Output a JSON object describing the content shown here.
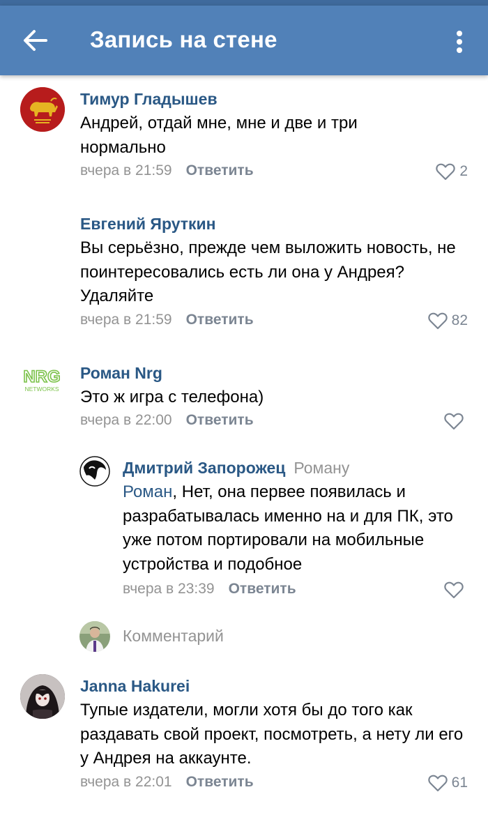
{
  "header": {
    "title": "Запись на стене"
  },
  "comments": [
    {
      "author": "Тимур Гладышев",
      "text": "Андрей, отдай мне, мне и две и три нормально",
      "time": "вчера в 21:59",
      "reply_label": "Ответить",
      "likes": "2",
      "avatar_icon": "caesars-legion-bull-icon"
    },
    {
      "author": "Евгений Яруткин",
      "text": "Вы серьёзно, прежде чем выложить новость, не поинтересовались есть ли она у Андрея? Удаляйте",
      "time": "вчера в 21:59",
      "reply_label": "Ответить",
      "likes": "82"
    },
    {
      "author": "Роман Nrg",
      "text": "Это ж игра с телефона)",
      "time": "вчера в 22:00",
      "reply_label": "Ответить",
      "likes": "",
      "avatar_logo_text_top": "NRG",
      "avatar_logo_text_bottom": "NETWORKS"
    },
    {
      "author": "Дмитрий Запорожец",
      "reply_to": "Роману",
      "mention": "Роман",
      "text": ", Нет, она первее появилась и разрабатывалась именно на и для ПК, это уже потом портировали на мобильные устройства и подобное",
      "time": "вчера в 23:39",
      "reply_label": "Ответить",
      "likes": ""
    },
    {
      "author": "Janna Hakurei",
      "text": "Тупые издатели, могли хотя бы до того как раздавать свой проект, посмотреть, а нету ли его у Андрея на аккаунте.",
      "time": "вчера в 22:01",
      "reply_label": "Ответить",
      "likes": "61"
    }
  ],
  "compose": {
    "placeholder": "Комментарий"
  },
  "colors": {
    "header_bg": "#5181b8",
    "author_link": "#2a5885",
    "meta_gray": "#939393",
    "action_gray": "#7b8592"
  }
}
